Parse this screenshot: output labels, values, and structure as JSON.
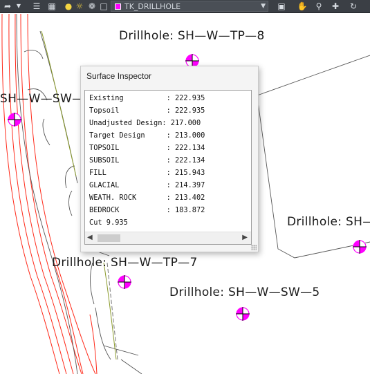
{
  "toolbar": {
    "layer_name": "TK_DRILLHOLE",
    "layer_color": "#ff00ff",
    "icons": [
      "arrow-icon",
      "dropdown-icon",
      "layer-properties-icon",
      "lightbulb-icon",
      "sun-icon",
      "freeze-icon",
      "lock-icon",
      "layer-icon",
      "pan-hand-icon",
      "zoom-window-icon",
      "zoom-extents-icon",
      "orbit-icon"
    ]
  },
  "inspector": {
    "title": "Surface Inspector",
    "rows": [
      "Existing          : 222.935",
      "Topsoil           : 222.935",
      "Unadjusted Design: 217.000",
      "Target Design     : 213.000",
      "TOPSOIL           : 222.134",
      "SUBSOIL           : 222.134",
      "FILL              : 215.943",
      "GLACIAL           : 214.397",
      "WEATH. ROCK       : 213.402",
      "BEDROCK           : 183.872",
      "Cut 9.935"
    ]
  },
  "drawing": {
    "labels": {
      "tp8": "Drillhole: SH—W—TP—8",
      "sw_left": "SH—W—SW—",
      "right": "Drillhole: SH—",
      "tp7": "Drillhole: SH—W—TP—7",
      "sw5": "Drillhole: SH—W—SW—5"
    },
    "marker_color": "#ff00ff",
    "contour_color": "#ff2a1a"
  }
}
